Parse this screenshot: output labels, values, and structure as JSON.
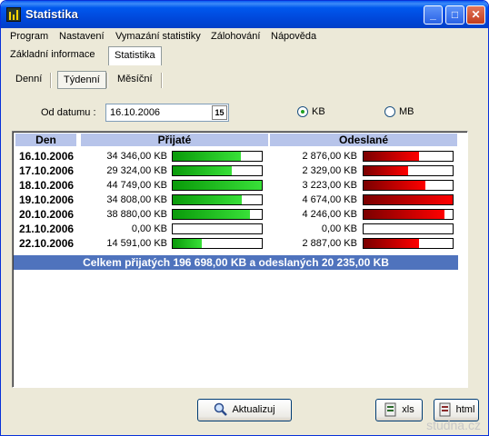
{
  "window": {
    "title": "Statistika"
  },
  "menu": [
    {
      "label": "Program"
    },
    {
      "label": "Nastavení"
    },
    {
      "label": "Vymazání statistiky"
    },
    {
      "label": "Zálohování"
    },
    {
      "label": "Nápověda"
    }
  ],
  "tabs": [
    {
      "label": "Základní informace"
    },
    {
      "label": "Statistika"
    }
  ],
  "subtabs": [
    {
      "label": "Denní"
    },
    {
      "label": "Týdenní"
    },
    {
      "label": "Měsíční"
    }
  ],
  "date_filter": {
    "label": "Od datumu :",
    "value": "16.10.2006",
    "calendar_badge": "15"
  },
  "unit": {
    "kb_label": "KB",
    "mb_label": "MB",
    "selected": "KB"
  },
  "table": {
    "headers": [
      "Den",
      "Přijaté",
      "Odeslané"
    ],
    "rows": [
      {
        "day": "16.10.2006",
        "received": "34 346,00 KB",
        "received_frac": 0.77,
        "sent": "2 876,00 KB",
        "sent_frac": 0.62
      },
      {
        "day": "17.10.2006",
        "received": "29 324,00 KB",
        "received_frac": 0.66,
        "sent": "2 329,00 KB",
        "sent_frac": 0.5
      },
      {
        "day": "18.10.2006",
        "received": "44 749,00 KB",
        "received_frac": 1.0,
        "sent": "3 223,00 KB",
        "sent_frac": 0.69
      },
      {
        "day": "19.10.2006",
        "received": "34 808,00 KB",
        "received_frac": 0.78,
        "sent": "4 674,00 KB",
        "sent_frac": 1.0
      },
      {
        "day": "20.10.2006",
        "received": "38 880,00 KB",
        "received_frac": 0.87,
        "sent": "4 246,00 KB",
        "sent_frac": 0.91
      },
      {
        "day": "21.10.2006",
        "received": "0,00 KB",
        "received_frac": 0,
        "sent": "0,00 KB",
        "sent_frac": 0
      },
      {
        "day": "22.10.2006",
        "received": "14 591,00 KB",
        "received_frac": 0.33,
        "sent": "2 887,00 KB",
        "sent_frac": 0.62
      }
    ],
    "total": "Celkem přijatých 196 698,00 KB a odeslaných 20 235,00 KB"
  },
  "buttons": {
    "refresh": "Aktualizuj",
    "xls": "xls",
    "html": "html"
  },
  "watermark": "studna.cz",
  "colors": {
    "received_bar": "#22c322",
    "sent_bar": "#d10000",
    "header_bg": "#b7c4ea",
    "total_bg": "#4f73bd"
  }
}
